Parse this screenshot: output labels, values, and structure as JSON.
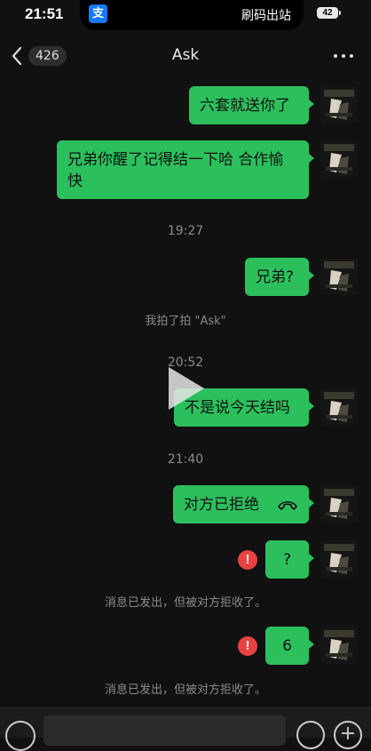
{
  "status_bar": {
    "time": "21:51",
    "app_badge": "支",
    "app_pill_text": "刷码出站",
    "battery": "42"
  },
  "nav": {
    "unread_count": "426",
    "title": "Ask"
  },
  "messages": [
    {
      "text": "六套就送你了"
    },
    {
      "text": "兄弟你醒了记得结一下哈 合作愉快"
    },
    {
      "text": "兄弟?"
    },
    {
      "text": "不是说今天结吗"
    },
    {
      "text": "对方已拒绝"
    },
    {
      "text": "?"
    },
    {
      "text": "6"
    }
  ],
  "timestamps": [
    "19:27",
    "20:52",
    "21:40"
  ],
  "system_notices": {
    "pat": "我拍了拍 \"Ask\"",
    "rejected_1": "消息已发出，但被对方拒收了。",
    "rejected_2": "消息已发出，但被对方拒收了。"
  },
  "error_mark": "!",
  "colors": {
    "bubble": "#2cc05d",
    "background": "#111111",
    "error": "#e64340"
  },
  "icons": [
    "chevron-left-icon",
    "more-icon",
    "phone-hangup-icon",
    "play-icon",
    "voice-icon",
    "emoji-icon",
    "plus-icon"
  ]
}
